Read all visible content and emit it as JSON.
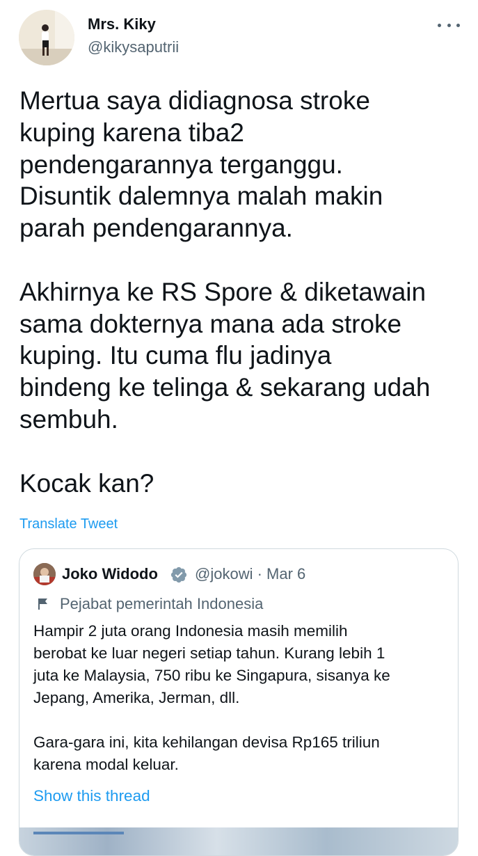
{
  "tweet": {
    "author_name": "Mrs. Kiky",
    "author_handle": "@kikysaputrii",
    "text": "Mertua saya didiagnosa stroke\nkuping karena tiba2\npendengarannya terganggu.\nDisuntik dalemnya malah makin\nparah pendengarannya.\n\nAkhirnya ke RS Spore & diketawain\nsama dokternya mana ada stroke\nkuping. Itu cuma flu jadinya\nbindeng ke telinga & sekarang udah\nsembuh.\n\nKocak kan?",
    "translate_label": "Translate Tweet"
  },
  "quote": {
    "author_name": "Joko Widodo",
    "handle_and_date": "@jokowi · Mar 6",
    "label": "Pejabat pemerintah Indonesia",
    "text": "Hampir 2 juta orang Indonesia masih memilih\nberobat ke luar negeri setiap tahun. Kurang lebih 1\njuta ke Malaysia, 750 ribu ke Singapura, sisanya ke\nJepang, Amerika, Jerman, dll.\n\nGara-gara ini, kita kehilangan devisa Rp165 triliun\nkarena modal keluar.",
    "show_thread_label": "Show this thread"
  },
  "icons": {
    "more": "more-horizontal-icon",
    "verified": "verified-badge-icon",
    "label": "flag-icon"
  },
  "colors": {
    "link": "#1d9bf0",
    "secondary_text": "#536471",
    "primary_text": "#0f1419",
    "border": "#cfd9de",
    "verified_badge": "#829aab"
  }
}
